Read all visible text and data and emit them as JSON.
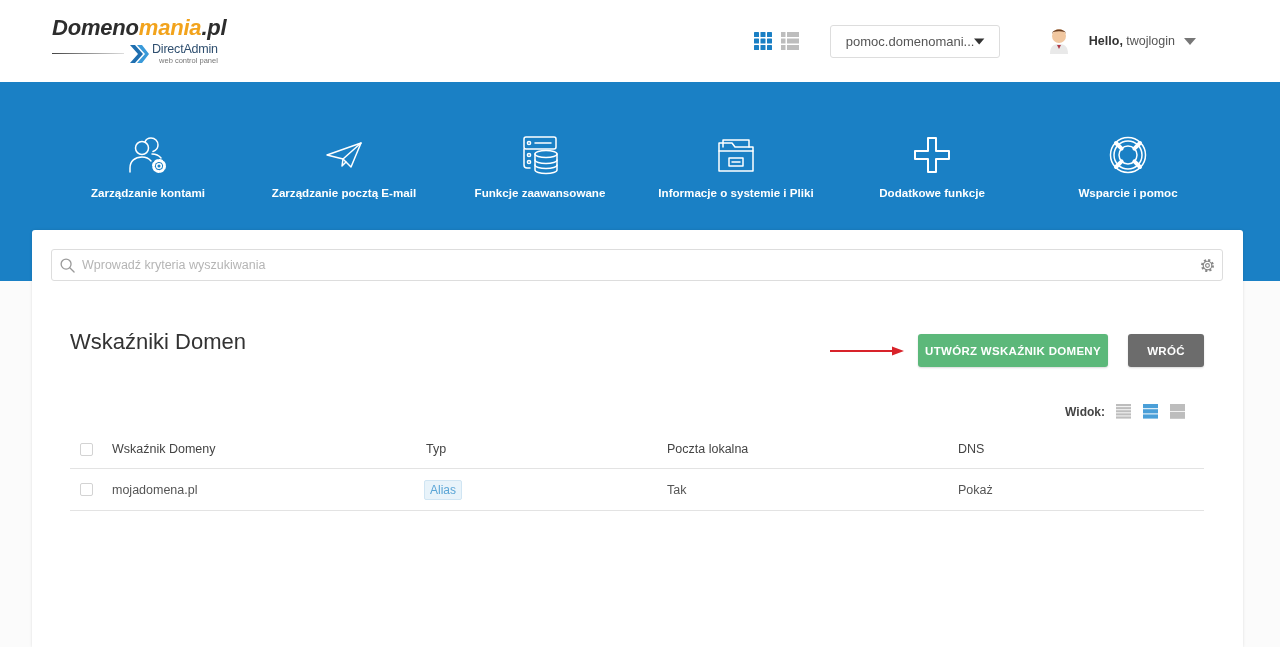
{
  "header": {
    "logo": {
      "parts": [
        {
          "text": "Domeno",
          "color": "#2d2d2d"
        },
        {
          "text": "mania",
          "color": "#f2a31c"
        },
        {
          "text": ".pl",
          "color": "#2d2d2d"
        }
      ],
      "sublogo": "DirectAdmin",
      "tagline": "web control panel"
    },
    "layout_toggles": [
      {
        "kind": "grid",
        "selected": true
      },
      {
        "kind": "list",
        "selected": false
      }
    ],
    "domain_select": {
      "value": "pomoc.domenomani..."
    },
    "user_menu": {
      "label": "**Hello,** twojlogin"
    }
  },
  "nav": [
    {
      "kind": "accounts",
      "label": "Zarządzanie kontami"
    },
    {
      "kind": "mail",
      "label": "Zarządzanie pocztą E-mail"
    },
    {
      "kind": "advanced",
      "label": "Funkcje zaawansowane"
    },
    {
      "kind": "system",
      "label": "Informacje o systemie i Pliki"
    },
    {
      "kind": "extra",
      "label": "Dodatkowe funkcje"
    },
    {
      "kind": "support",
      "label": "Wsparcie i pomoc"
    }
  ],
  "search": {
    "placeholder": "Wprowadź kryteria wyszukiwania"
  },
  "page": {
    "title": "Wskaźniki Domen",
    "buttons": [
      {
        "kind": "primary",
        "label": "UTWÓRZ WSKAŹNIK DOMENY"
      },
      {
        "kind": "secondary",
        "label": "WRÓĆ"
      }
    ],
    "view": {
      "label": "Widok:",
      "options": [
        {
          "kind": "compact",
          "selected": false
        },
        {
          "kind": "normal",
          "selected": true
        },
        {
          "kind": "large",
          "selected": false
        }
      ]
    }
  },
  "table": {
    "select_all": {
      "checked": false
    },
    "columns": [
      {
        "label": "Wskaźnik Domeny",
        "kind": "text"
      },
      {
        "label": "Typ",
        "kind": "badge"
      },
      {
        "label": "Poczta lokalna",
        "kind": "text"
      },
      {
        "label": "DNS",
        "kind": "text"
      }
    ],
    "rows": [
      {
        "checked": false,
        "cells": [
          "mojadomena.pl",
          "Alias",
          "Tak",
          "Pokaż"
        ]
      }
    ]
  }
}
